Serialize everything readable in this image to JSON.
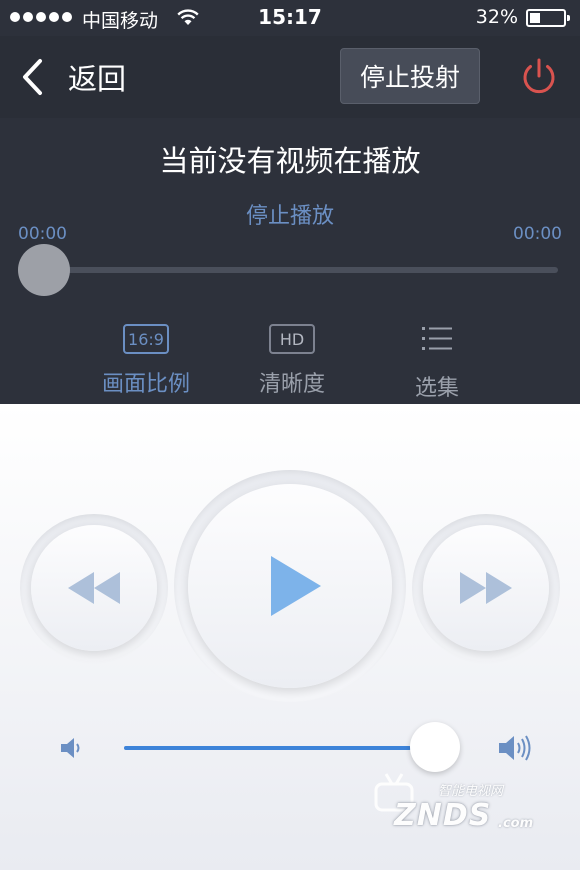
{
  "status_bar": {
    "carrier": "中国移动",
    "time": "15:17",
    "battery": "32%"
  },
  "nav": {
    "back_label": "返回",
    "stop_cast_label": "停止投射"
  },
  "player": {
    "status_text": "当前没有视频在播放",
    "stop_play_label": "停止播放",
    "time_current": "00:00",
    "time_total": "00:00",
    "progress": 0
  },
  "options": {
    "ratio_badge": "16:9",
    "ratio_label": "画面比例",
    "quality_badge": "HD",
    "quality_label": "清晰度",
    "episodes_label": "选集"
  },
  "volume": {
    "level": 0.92
  },
  "watermark": {
    "top": "智能电视网",
    "main": "ZNDS",
    "domain": ".com"
  },
  "colors": {
    "accent": "#6b8fc3",
    "volume_fill": "#3d83d9",
    "power": "#d9534f",
    "play": "#7db3ea"
  }
}
